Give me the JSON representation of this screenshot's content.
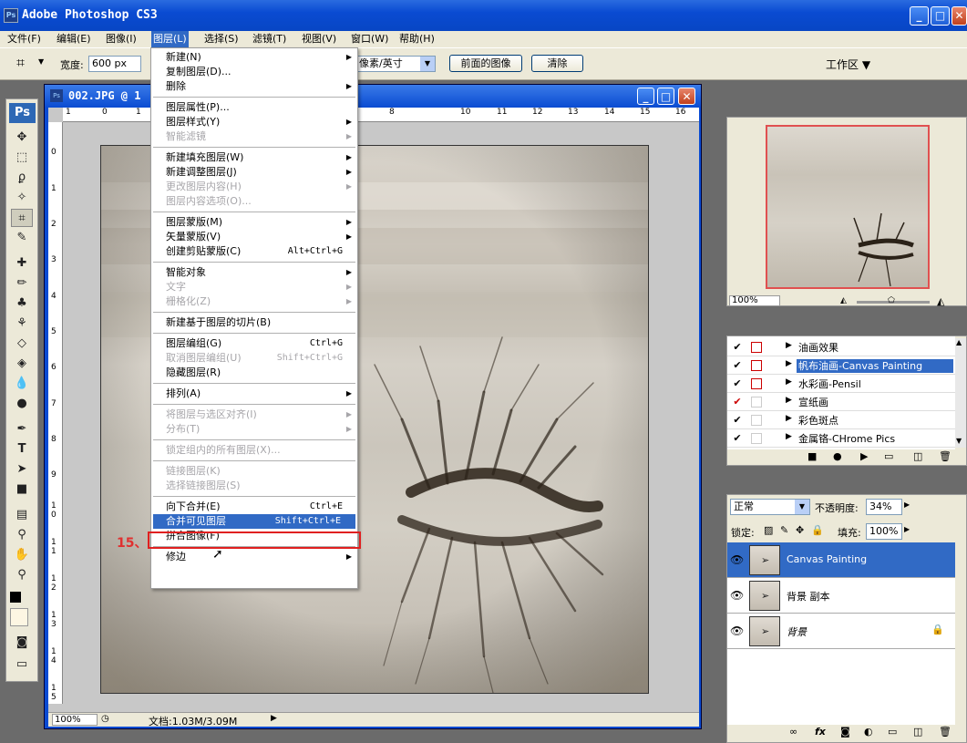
{
  "app": {
    "title": "Adobe Photoshop CS3",
    "logo": "Ps"
  },
  "window_buttons": {
    "min": "_",
    "max": "□",
    "close": "✕"
  },
  "menubar": [
    "文件(F)",
    "编辑(E)",
    "图像(I)",
    "图层(L)",
    "选择(S)",
    "滤镜(T)",
    "视图(V)",
    "窗口(W)",
    "帮助(H)"
  ],
  "options": {
    "width_label": "宽度:",
    "width_value": "600 px",
    "resolution_unit": "像素/英寸",
    "front_image": "前面的图像",
    "clear": "清除",
    "workspace": "工作区 ▼"
  },
  "document": {
    "title": "002.JPG @ 1",
    "zoom": "100%",
    "status": "文档:1.03M/3.09M",
    "ruler_h": [
      "1",
      "0",
      "1",
      "8",
      "10",
      "11",
      "12",
      "13",
      "14",
      "15",
      "16"
    ],
    "ruler_v": [
      "0",
      "1",
      "2",
      "3",
      "4",
      "5",
      "6",
      "7",
      "8",
      "9",
      "1",
      "0",
      "1",
      "1",
      "1",
      "2",
      "1",
      "3",
      "1",
      "4",
      "1",
      "5"
    ]
  },
  "layer_menu": {
    "items": [
      {
        "label": "新建(N)",
        "arrow": true
      },
      {
        "label": "复制图层(D)..."
      },
      {
        "label": "删除",
        "arrow": true
      },
      {
        "sep": true
      },
      {
        "label": "图层属性(P)..."
      },
      {
        "label": "图层样式(Y)",
        "arrow": true
      },
      {
        "label": "智能滤镜",
        "disabled": true,
        "arrow": true
      },
      {
        "sep": true
      },
      {
        "label": "新建填充图层(W)",
        "arrow": true
      },
      {
        "label": "新建调整图层(J)",
        "arrow": true
      },
      {
        "label": "更改图层内容(H)",
        "disabled": true,
        "arrow": true
      },
      {
        "label": "图层内容选项(O)...",
        "disabled": true
      },
      {
        "sep": true
      },
      {
        "label": "图层蒙版(M)",
        "arrow": true
      },
      {
        "label": "矢量蒙版(V)",
        "arrow": true
      },
      {
        "label": "创建剪贴蒙版(C)",
        "shortcut": "Alt+Ctrl+G"
      },
      {
        "sep": true
      },
      {
        "label": "智能对象",
        "arrow": true
      },
      {
        "label": "文字",
        "disabled": true,
        "arrow": true
      },
      {
        "label": "栅格化(Z)",
        "disabled": true,
        "arrow": true
      },
      {
        "sep": true
      },
      {
        "label": "新建基于图层的切片(B)"
      },
      {
        "sep": true
      },
      {
        "label": "图层编组(G)",
        "shortcut": "Ctrl+G"
      },
      {
        "label": "取消图层编组(U)",
        "shortcut": "Shift+Ctrl+G",
        "disabled": true
      },
      {
        "label": "隐藏图层(R)"
      },
      {
        "sep": true
      },
      {
        "label": "排列(A)",
        "arrow": true
      },
      {
        "sep": true
      },
      {
        "label": "将图层与选区对齐(I)",
        "disabled": true,
        "arrow": true
      },
      {
        "label": "分布(T)",
        "disabled": true,
        "arrow": true
      },
      {
        "sep": true
      },
      {
        "label": "锁定组内的所有图层(X)...",
        "disabled": true
      },
      {
        "sep": true
      },
      {
        "label": "链接图层(K)",
        "disabled": true
      },
      {
        "label": "选择链接图层(S)",
        "disabled": true
      },
      {
        "sep": true
      },
      {
        "label": "向下合并(E)",
        "shortcut": "Ctrl+E"
      },
      {
        "label": "合并可见图层",
        "shortcut": "Shift+Ctrl+E",
        "highlight": true
      },
      {
        "label": "拼合图像(F)"
      },
      {
        "sep": true
      },
      {
        "label": "修边",
        "arrow": true
      }
    ]
  },
  "step_label": "15、",
  "navigator": {
    "zoom": "100%"
  },
  "actions": [
    {
      "label": "油画效果",
      "checked": true,
      "red": true
    },
    {
      "label": "帆布油画-Canvas Painting",
      "checked": true,
      "red": true,
      "selected": true
    },
    {
      "label": "水彩画-Pensil",
      "checked": true,
      "red": true
    },
    {
      "label": "宣纸画",
      "checked": true,
      "red": false,
      "red_check": true
    },
    {
      "label": "彩色斑点",
      "checked": true,
      "red": false
    },
    {
      "label": "金属铬-CHrome Pics",
      "checked": true,
      "red": false
    }
  ],
  "layers": {
    "blend": "正常",
    "opacity_label": "不透明度:",
    "opacity": "34%",
    "lock_label": "锁定:",
    "fill_label": "填充:",
    "fill": "100%",
    "items": [
      {
        "name": "Canvas Painting",
        "selected": true
      },
      {
        "name": "背景 副本",
        "selected": false
      },
      {
        "name": "背景",
        "selected": false,
        "locked": true
      }
    ]
  }
}
